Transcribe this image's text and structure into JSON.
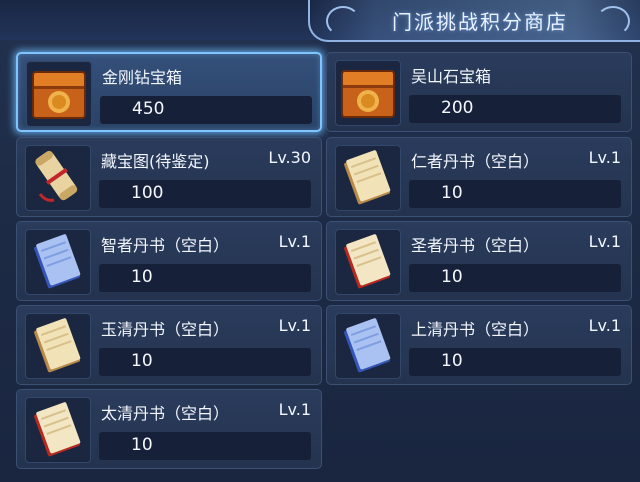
{
  "shop": {
    "title": "门派挑战积分商店"
  },
  "items": [
    {
      "name": "金刚钻宝箱",
      "level": "",
      "price": "450",
      "icon": "treasure-chest-icon"
    },
    {
      "name": "吴山石宝箱",
      "level": "",
      "price": "200",
      "icon": "treasure-chest-icon"
    },
    {
      "name": "藏宝图(待鉴定)",
      "level": "Lv.30",
      "price": "100",
      "icon": "treasure-map-scroll-icon"
    },
    {
      "name": "仁者丹书（空白）",
      "level": "Lv.1",
      "price": "10",
      "icon": "tan-book-icon"
    },
    {
      "name": "智者丹书（空白）",
      "level": "Lv.1",
      "price": "10",
      "icon": "blue-book-icon"
    },
    {
      "name": "圣者丹书（空白）",
      "level": "Lv.1",
      "price": "10",
      "icon": "red-book-icon"
    },
    {
      "name": "玉清丹书（空白）",
      "level": "Lv.1",
      "price": "10",
      "icon": "tan-book-icon"
    },
    {
      "name": "上清丹书（空白）",
      "level": "Lv.1",
      "price": "10",
      "icon": "blue-book-icon"
    },
    {
      "name": "太清丹书（空白）",
      "level": "Lv.1",
      "price": "10",
      "icon": "red-book-icon"
    }
  ],
  "colors": {
    "panel_bg": "#1c2a44",
    "selected_glow": "#7fc4ff",
    "price_bar": "#162038"
  }
}
